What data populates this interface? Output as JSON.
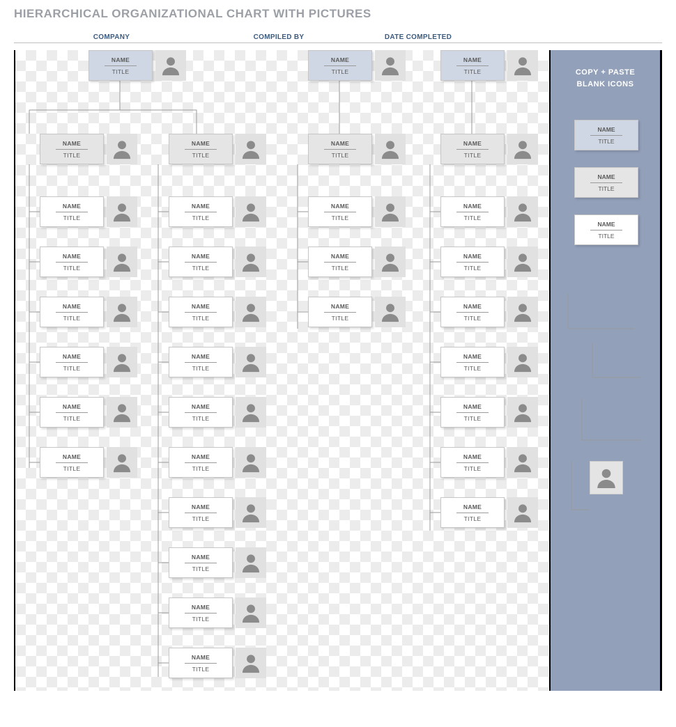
{
  "header": {
    "title": "HIERARCHICAL ORGANIZATIONAL CHART WITH PICTURES",
    "col1": "COMPANY",
    "col2": "COMPILED BY",
    "col3": "DATE COMPLETED"
  },
  "labels": {
    "name": "NAME",
    "title": "TITLE"
  },
  "sidebar": {
    "heading1": "COPY + PASTE",
    "heading2": "BLANK ICONS"
  }
}
